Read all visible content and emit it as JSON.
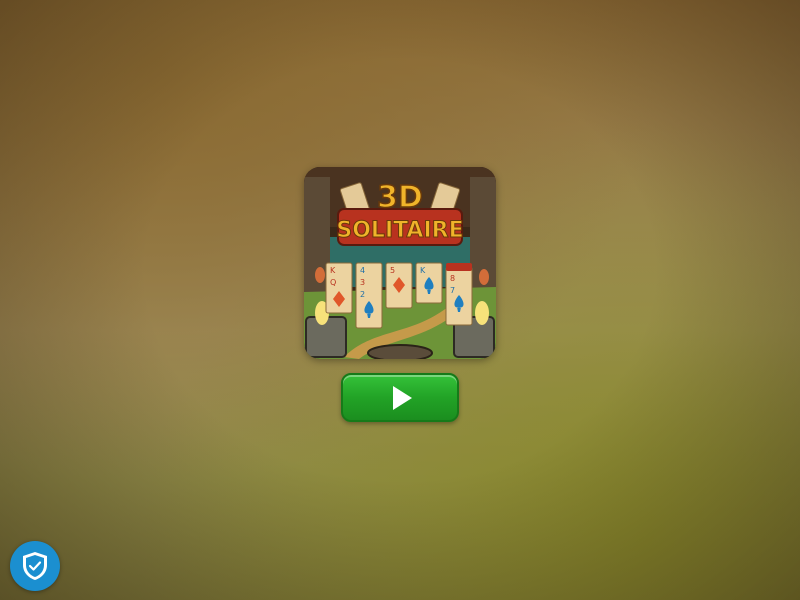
{
  "game": {
    "title_line1": "3D",
    "title_line2": "SOLITAIRE",
    "thumbnail_icon": "game-thumbnail"
  },
  "play_button": {
    "icon": "play-icon",
    "color": "#22a326"
  },
  "privacy_badge": {
    "icon": "shield-check-icon",
    "color": "#1b8fd0"
  },
  "colors": {
    "background_top": "#8c6a35",
    "background_bottom": "#837f3e",
    "logo_gold": "#f0b42a",
    "logo_red": "#b8321f"
  }
}
